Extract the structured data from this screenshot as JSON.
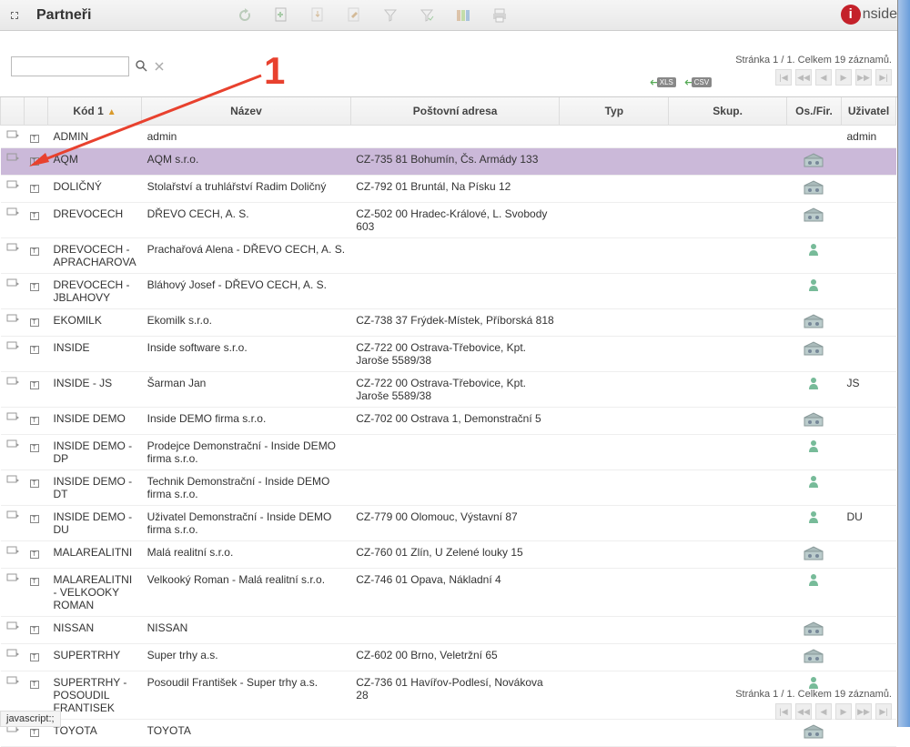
{
  "toolbar": {
    "title": "Partneři"
  },
  "logo": {
    "text": "nside",
    "circle": "i"
  },
  "search": {
    "placeholder": ""
  },
  "pager": {
    "text": "Stránka 1 / 1. Celkem 19 záznamů."
  },
  "export": {
    "xls": "XLS",
    "csv": "CSV"
  },
  "annotation": {
    "number": "1"
  },
  "columns": {
    "kod": "Kód 1",
    "nazev": "Název",
    "addr": "Poštovní adresa",
    "typ": "Typ",
    "skup": "Skup.",
    "osfir": "Os./Fir.",
    "uzi": "Uživatel"
  },
  "rows": [
    {
      "kod": "ADMIN",
      "nazev": "admin",
      "addr": "",
      "typ": "",
      "skup": "",
      "osfir": "",
      "uzi": "admin",
      "selected": false
    },
    {
      "kod": "AQM",
      "nazev": "AQM s.r.o.",
      "addr": "CZ-735 81 Bohumín, Čs. Armády 133",
      "typ": "",
      "skup": "",
      "osfir": "company",
      "uzi": "",
      "selected": true
    },
    {
      "kod": "DOLIČNÝ",
      "nazev": "Stolařství a truhlářství Radim Doličný",
      "addr": "CZ-792 01 Bruntál, Na Písku 12",
      "typ": "",
      "skup": "",
      "osfir": "company",
      "uzi": "",
      "selected": false
    },
    {
      "kod": "DREVOCECH",
      "nazev": "DŘEVO CECH, A. S.",
      "addr": "CZ-502 00 Hradec-Králové, L. Svobody 603",
      "typ": "",
      "skup": "",
      "osfir": "company",
      "uzi": "",
      "selected": false
    },
    {
      "kod": "DREVOCECH - APRACHAROVA",
      "nazev": "Prachařová Alena - DŘEVO CECH, A. S.",
      "addr": "",
      "typ": "",
      "skup": "",
      "osfir": "person",
      "uzi": "",
      "selected": false
    },
    {
      "kod": "DREVOCECH - JBLAHOVY",
      "nazev": "Bláhový Josef - DŘEVO CECH, A. S.",
      "addr": "",
      "typ": "",
      "skup": "",
      "osfir": "person",
      "uzi": "",
      "selected": false
    },
    {
      "kod": "EKOMILK",
      "nazev": "Ekomilk s.r.o.",
      "addr": "CZ-738 37 Frýdek-Místek, Příborská 818",
      "typ": "",
      "skup": "",
      "osfir": "company",
      "uzi": "",
      "selected": false
    },
    {
      "kod": "INSIDE",
      "nazev": "Inside software s.r.o.",
      "addr": "CZ-722 00 Ostrava-Třebovice, Kpt. Jaroše 5589/38",
      "typ": "",
      "skup": "",
      "osfir": "company",
      "uzi": "",
      "selected": false
    },
    {
      "kod": "INSIDE - JS",
      "nazev": "Šarman Jan",
      "addr": "CZ-722 00 Ostrava-Třebovice, Kpt. Jaroše 5589/38",
      "typ": "",
      "skup": "",
      "osfir": "person",
      "uzi": "JS",
      "selected": false
    },
    {
      "kod": "INSIDE DEMO",
      "nazev": "Inside DEMO firma s.r.o.",
      "addr": "CZ-702 00 Ostrava 1, Demonstrační 5",
      "typ": "",
      "skup": "",
      "osfir": "company",
      "uzi": "",
      "selected": false
    },
    {
      "kod": "INSIDE DEMO - DP",
      "nazev": "Prodejce Demonstrační - Inside DEMO firma s.r.o.",
      "addr": "",
      "typ": "",
      "skup": "",
      "osfir": "person",
      "uzi": "",
      "selected": false
    },
    {
      "kod": "INSIDE DEMO - DT",
      "nazev": "Technik Demonstrační - Inside DEMO firma s.r.o.",
      "addr": "",
      "typ": "",
      "skup": "",
      "osfir": "person",
      "uzi": "",
      "selected": false
    },
    {
      "kod": "INSIDE DEMO - DU",
      "nazev": "Uživatel Demonstrační - Inside DEMO firma s.r.o.",
      "addr": "CZ-779 00 Olomouc, Výstavní 87",
      "typ": "",
      "skup": "",
      "osfir": "person",
      "uzi": "DU",
      "selected": false
    },
    {
      "kod": "MALAREALITNI",
      "nazev": "Malá realitní s.r.o.",
      "addr": "CZ-760 01 Zlín, U Zelené louky 15",
      "typ": "",
      "skup": "",
      "osfir": "company",
      "uzi": "",
      "selected": false
    },
    {
      "kod": "MALAREALITNI - VELKOOKY ROMAN",
      "nazev": "Velkooký Roman - Malá realitní s.r.o.",
      "addr": "CZ-746 01 Opava, Nákladní 4",
      "typ": "",
      "skup": "",
      "osfir": "person",
      "uzi": "",
      "selected": false
    },
    {
      "kod": "NISSAN",
      "nazev": "NISSAN",
      "addr": "",
      "typ": "",
      "skup": "",
      "osfir": "company",
      "uzi": "",
      "selected": false
    },
    {
      "kod": "SUPERTRHY",
      "nazev": "Super trhy a.s.",
      "addr": "CZ-602 00 Brno, Veletržní 65",
      "typ": "",
      "skup": "",
      "osfir": "company",
      "uzi": "",
      "selected": false
    },
    {
      "kod": "SUPERTRHY - POSOUDIL FRANTISEK",
      "nazev": "Posoudil František - Super trhy a.s.",
      "addr": "CZ-736 01 Havířov-Podlesí, Novákova 28",
      "typ": "",
      "skup": "",
      "osfir": "person",
      "uzi": "",
      "selected": false
    },
    {
      "kod": "TOYOTA",
      "nazev": "TOYOTA",
      "addr": "",
      "typ": "",
      "skup": "",
      "osfir": "company",
      "uzi": "",
      "selected": false
    }
  ],
  "status": "javascript:;"
}
